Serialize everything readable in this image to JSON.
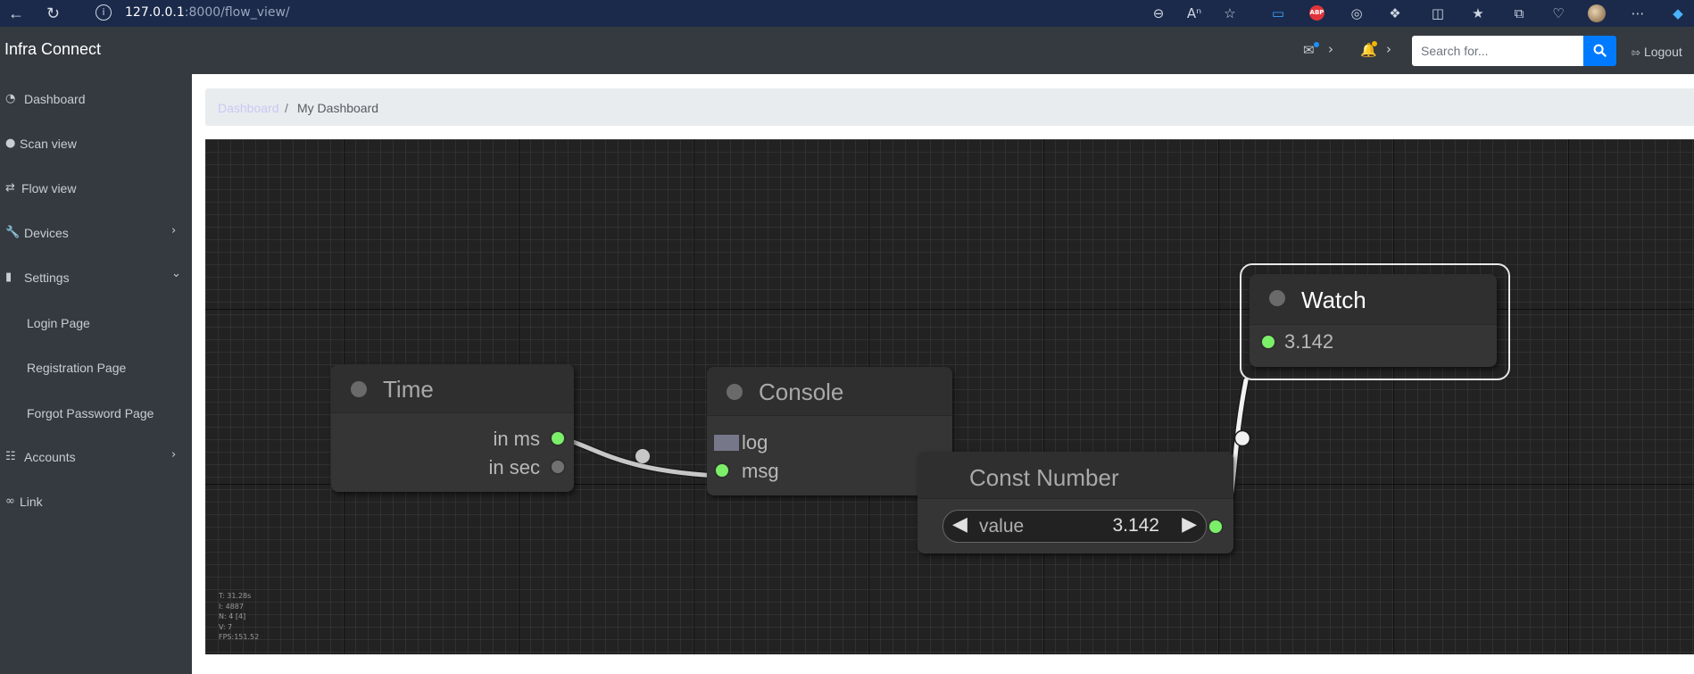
{
  "browser": {
    "url_host": "127.0.0.1",
    "url_path": ":8000/flow_view/",
    "back_icon": "arrow-left-icon",
    "reload_icon": "reload-icon",
    "abp_label": "ABP"
  },
  "topnav": {
    "brand": "Infra Connect",
    "search_placeholder": "Search for...",
    "logout_label": "Logout",
    "mail_badge_color": "#1e90ff",
    "bell_badge_color": "#f0b400"
  },
  "sidebar": {
    "items": [
      {
        "label": "Dashboard",
        "icon": "dashboard-icon"
      },
      {
        "label": "Scan view",
        "icon": "globe-icon"
      },
      {
        "label": "Flow view",
        "icon": "random-icon"
      },
      {
        "label": "Devices",
        "icon": "wrench-icon"
      },
      {
        "label": "Settings",
        "icon": "file-icon"
      },
      {
        "label": "Login Page"
      },
      {
        "label": "Registration Page"
      },
      {
        "label": "Forgot Password Page"
      },
      {
        "label": "Accounts",
        "icon": "sitemap-icon"
      },
      {
        "label": "Link",
        "icon": "link-icon"
      }
    ]
  },
  "breadcrumb": {
    "link": "Dashboard",
    "separator": "/",
    "current": "My Dashboard"
  },
  "graph": {
    "nodes": {
      "time": {
        "title": "Time",
        "outputs": [
          "in ms",
          "in sec"
        ]
      },
      "console": {
        "title": "Console",
        "inputs": [
          "log",
          "msg"
        ]
      },
      "const_number": {
        "title": "Const Number",
        "widget_label": "value",
        "widget_value": "3.142"
      },
      "watch": {
        "title": "Watch",
        "value": "3.142"
      }
    },
    "stats": [
      "T: 31.28s",
      "I: 4887",
      "N: 4 [4]",
      "V: 7",
      "FPS:151.52"
    ]
  }
}
